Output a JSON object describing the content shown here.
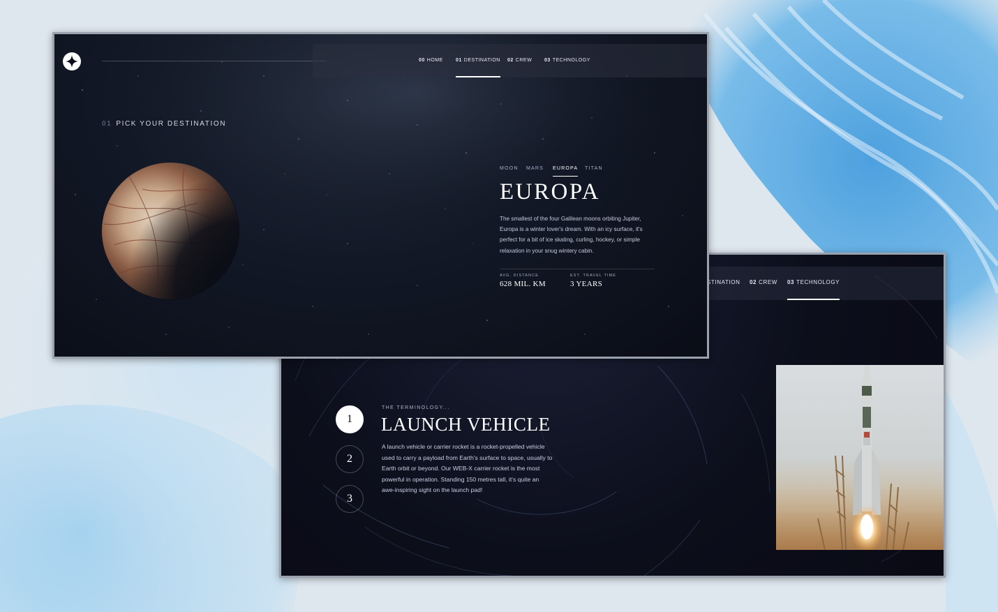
{
  "destination_page": {
    "nav": [
      {
        "num": "00",
        "label": "HOME"
      },
      {
        "num": "01",
        "label": "DESTINATION"
      },
      {
        "num": "02",
        "label": "CREW"
      },
      {
        "num": "03",
        "label": "TECHNOLOGY"
      }
    ],
    "active_nav": "DESTINATION",
    "heading": {
      "num": "01",
      "text": "PICK YOUR DESTINATION"
    },
    "tabs": [
      "MOON",
      "MARS",
      "EUROPA",
      "TITAN"
    ],
    "active_tab": "EUROPA",
    "name": "EUROPA",
    "description": "The smallest of the four Galilean moons orbiting Jupiter, Europa is a winter lover's dream. With an icy surface, it's perfect for a bit of ice skating, curling, hockey, or simple relaxation in your snug wintery cabin.",
    "stats": {
      "distance_label": "AVG. DISTANCE",
      "distance_value": "628 MIL. KM",
      "travel_label": "EST. TRAVEL TIME",
      "travel_value": "3 YEARS"
    }
  },
  "technology_page": {
    "nav": [
      {
        "num": "",
        "label": "STINATION"
      },
      {
        "num": "02",
        "label": "CREW"
      },
      {
        "num": "03",
        "label": "TECHNOLOGY"
      }
    ],
    "active_nav": "TECHNOLOGY",
    "steps": [
      "1",
      "2",
      "3"
    ],
    "active_step": "1",
    "eyebrow": "THE TERMINOLOGY...",
    "title": "LAUNCH VEHICLE",
    "description": "A launch vehicle or carrier rocket is a rocket-propelled vehicle used to carry a payload from Earth's surface to space, usually to Earth orbit or beyond. Our WEB-X carrier rocket is the most powerful in operation. Standing 150 metres tall, it's quite an awe-inspiring sight on the launch pad!"
  },
  "colors": {
    "page_bg": "#dfe7ee",
    "space_dark": "#0b0d17",
    "accent_white": "#ffffff",
    "muted_text": "#d0d6f9",
    "watercolor_blue": "#4aa3e0"
  }
}
